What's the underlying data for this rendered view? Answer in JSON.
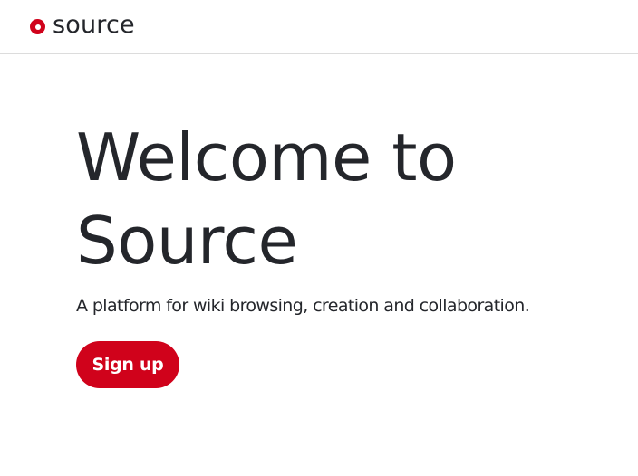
{
  "header": {
    "logo_text": "source",
    "logo_icon": "source-logo-mark"
  },
  "hero": {
    "title": "Welcome to Source",
    "subtitle": "A platform for wiki browsing, creation and collaboration.",
    "signup_label": "Sign up"
  },
  "colors": {
    "brand_red": "#d0021b",
    "text_dark": "#24262b",
    "divider": "#dcdcdc",
    "background": "#ffffff"
  }
}
